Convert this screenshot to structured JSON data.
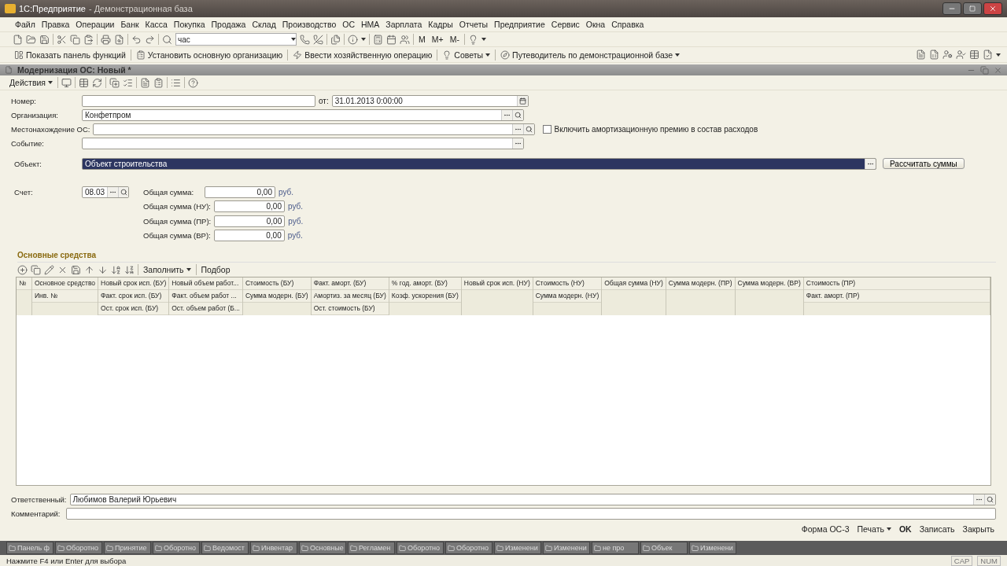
{
  "window": {
    "app": "1С:Предприятие",
    "base": "- Демонстрационная база"
  },
  "menu": [
    "Файл",
    "Правка",
    "Операции",
    "Банк",
    "Касса",
    "Покупка",
    "Продажа",
    "Склад",
    "Производство",
    "ОС",
    "НМА",
    "Зарплата",
    "Кадры",
    "Отчеты",
    "Предприятие",
    "Сервис",
    "Окна",
    "Справка"
  ],
  "toolbar": {
    "search_value": "час",
    "memory_buttons": [
      "M",
      "M+",
      "M-"
    ]
  },
  "panel_toolbar": [
    "Показать панель функций",
    "Установить основную организацию",
    "Ввести хозяйственную операцию",
    "Советы",
    "Путеводитель по демонстрационной базе"
  ],
  "document": {
    "title": "Модернизация ОС: Новый *",
    "actions": "Действия",
    "fields": [
      {
        "label": "Номер:",
        "date_label": "от:",
        "date": "31.01.2013  0:00:00",
        "calendar_button": true,
        "choose_button": false,
        "search_button": false
      },
      {
        "label": "Организация:",
        "value": "Конфетпром",
        "choose_button": true,
        "search_button": true,
        "calendar_button": false
      },
      {
        "label": "Местонахождение ОС:",
        "choose_button": true,
        "search_button": true,
        "calendar_button": false,
        "checkbox": {
          "label": "Включить амортизационную премию в состав расходов",
          "checked": false
        }
      },
      {
        "label": "Событие:",
        "choose_button": true,
        "search_button": false,
        "calendar_button": false
      }
    ],
    "object": {
      "label": "Объект:",
      "value": "Объект строительства",
      "selected": true,
      "button": "Рассчитать суммы"
    },
    "account": {
      "label": "Счет:",
      "value": "08.03"
    },
    "sums": [
      {
        "label": "Общая сумма:",
        "value": "0,00",
        "unit": "руб."
      },
      {
        "label": "Общая сумма (НУ):",
        "value": "0,00",
        "unit": "руб."
      },
      {
        "label": "Общая сумма (ПР):",
        "value": "0,00",
        "unit": "руб."
      },
      {
        "label": "Общая сумма (ВР):",
        "value": "0,00",
        "unit": "руб."
      }
    ],
    "section": "Основные средства",
    "table_toolbar": {
      "fill": "Заполнить",
      "pick": "Подбор"
    },
    "columns": [
      {
        "lines": [
          "№"
        ]
      },
      {
        "lines": [
          "Основное средство",
          "Инв. №"
        ]
      },
      {
        "lines": [
          "Новый срок исп. (БУ)",
          "Факт. срок исп. (БУ)",
          "Ост. срок исп. (БУ)"
        ]
      },
      {
        "lines": [
          "Новый объем работ...",
          "Факт. объем работ ...",
          "Ост. объем работ (Б..."
        ]
      },
      {
        "lines": [
          "Стоимость (БУ)",
          "Сумма модерн. (БУ)"
        ]
      },
      {
        "lines": [
          "Факт. аморт. (БУ)",
          "Амортиз. за месяц (БУ)",
          "Ост. стоимость (БУ)"
        ]
      },
      {
        "lines": [
          "% год. аморт. (БУ)",
          "Коэф. ускорения (БУ)"
        ]
      },
      {
        "lines": [
          "Новый срок исп. (НУ)"
        ]
      },
      {
        "lines": [
          "Стоимость (НУ)",
          "Сумма модерн. (НУ)"
        ]
      },
      {
        "lines": [
          "Общая сумма (НУ)"
        ]
      },
      {
        "lines": [
          "Сумма модерн. (ПР)"
        ]
      },
      {
        "lines": [
          "Сумма модерн. (ВР)"
        ]
      },
      {
        "lines": [
          "Стоимость (ПР)",
          "Факт. аморт. (ПР)"
        ]
      }
    ],
    "responsible": {
      "label": "Ответственный:",
      "value": "Любимов Валерий Юрьевич"
    },
    "comment": {
      "label": "Комментарий:"
    },
    "footer_buttons": [
      {
        "label": "Форма ОС-3",
        "kind": "plain"
      },
      {
        "label": "Печать",
        "kind": "menu"
      },
      {
        "label": "OK",
        "kind": "default"
      },
      {
        "label": "Записать",
        "kind": "plain"
      },
      {
        "label": "Закрыть",
        "kind": "plain"
      }
    ]
  },
  "taskbar": [
    "Панель ф",
    "Оборотно",
    "Принятие",
    "Оборотно",
    "Ведомост",
    "Инвентар",
    "Основные",
    "Регламен",
    "Оборотно",
    "Оборотно",
    "Изменени",
    "Изменени",
    "не про",
    "Объек",
    "Изменени"
  ],
  "status": {
    "hint": "Нажмите F4 или Enter для выбора",
    "indicators": [
      "CAP",
      "NUM"
    ]
  }
}
